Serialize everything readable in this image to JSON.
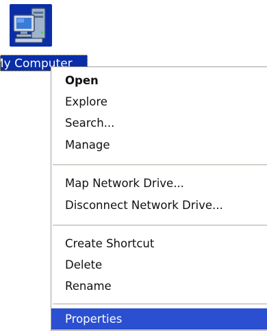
{
  "desktop": {
    "icon": {
      "name": "my-computer-icon",
      "label": "My Computer",
      "selection_color": "#0b2ea8"
    }
  },
  "context_menu": {
    "groups": [
      {
        "items": [
          {
            "label": "Open",
            "default": true
          },
          {
            "label": "Explore"
          },
          {
            "label": "Search..."
          },
          {
            "label": "Manage"
          }
        ]
      },
      {
        "items": [
          {
            "label": "Map Network Drive..."
          },
          {
            "label": "Disconnect Network Drive..."
          }
        ]
      },
      {
        "items": [
          {
            "label": "Create Shortcut"
          },
          {
            "label": "Delete"
          },
          {
            "label": "Rename"
          }
        ]
      },
      {
        "items": [
          {
            "label": "Properties",
            "selected": true
          }
        ]
      }
    ],
    "highlight_color": "#2a4fd0"
  }
}
